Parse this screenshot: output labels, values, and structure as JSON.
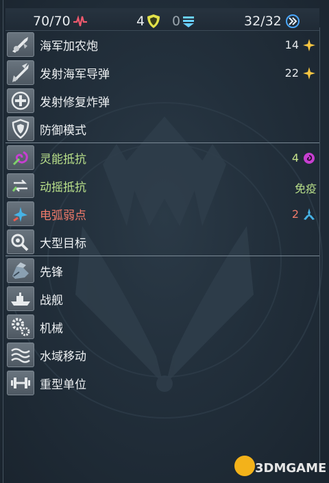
{
  "status": {
    "health": "70/70",
    "shield": "4",
    "armor": "0",
    "speed": "32/32"
  },
  "rows": [
    {
      "icon": "naval-cannon-icon",
      "label": "海军加农炮",
      "value": "14",
      "value_icon": "starburst-icon",
      "value_color": "#f5c542"
    },
    {
      "icon": "naval-missile-icon",
      "label": "发射海军导弹",
      "value": "22",
      "value_icon": "starburst-icon",
      "value_color": "#f5c542"
    },
    {
      "icon": "repair-bomb-icon",
      "label": "发射修复炸弹",
      "value": "",
      "value_icon": ""
    },
    {
      "icon": "shield-mode-icon",
      "label": "防御模式",
      "value": "",
      "value_icon": ""
    },
    {
      "icon": "psionic-icon",
      "label": "灵能抵抗",
      "value": "4",
      "value_icon": "psionic-swirl-icon",
      "value_color": "#c73fd1"
    },
    {
      "icon": "shock-icon",
      "label": "动摇抵抗",
      "value": "免疫",
      "value_icon": ""
    },
    {
      "icon": "arc-icon",
      "label": "电弧弱点",
      "value": "2",
      "value_icon": "arc-triad-icon",
      "value_color": "#46b3e6"
    },
    {
      "icon": "large-target-icon",
      "label": "大型目标",
      "value": "",
      "value_icon": ""
    },
    {
      "icon": "vanguard-icon",
      "label": "先锋",
      "value": "",
      "value_icon": ""
    },
    {
      "icon": "warship-icon",
      "label": "战舰",
      "value": "",
      "value_icon": ""
    },
    {
      "icon": "gears-icon",
      "label": "机械",
      "value": "",
      "value_icon": ""
    },
    {
      "icon": "waves-icon",
      "label": "水域移动",
      "value": "",
      "value_icon": ""
    },
    {
      "icon": "dumbbell-icon",
      "label": "重型单位",
      "value": "",
      "value_icon": ""
    }
  ],
  "watermark": {
    "text": "3DMGAME"
  },
  "colors": {
    "health_icon": "#f05a6e",
    "shield_icon": "#e2e24a",
    "armor_icon": "#6ad0ff",
    "speed_icon": "#4aa8ff"
  }
}
